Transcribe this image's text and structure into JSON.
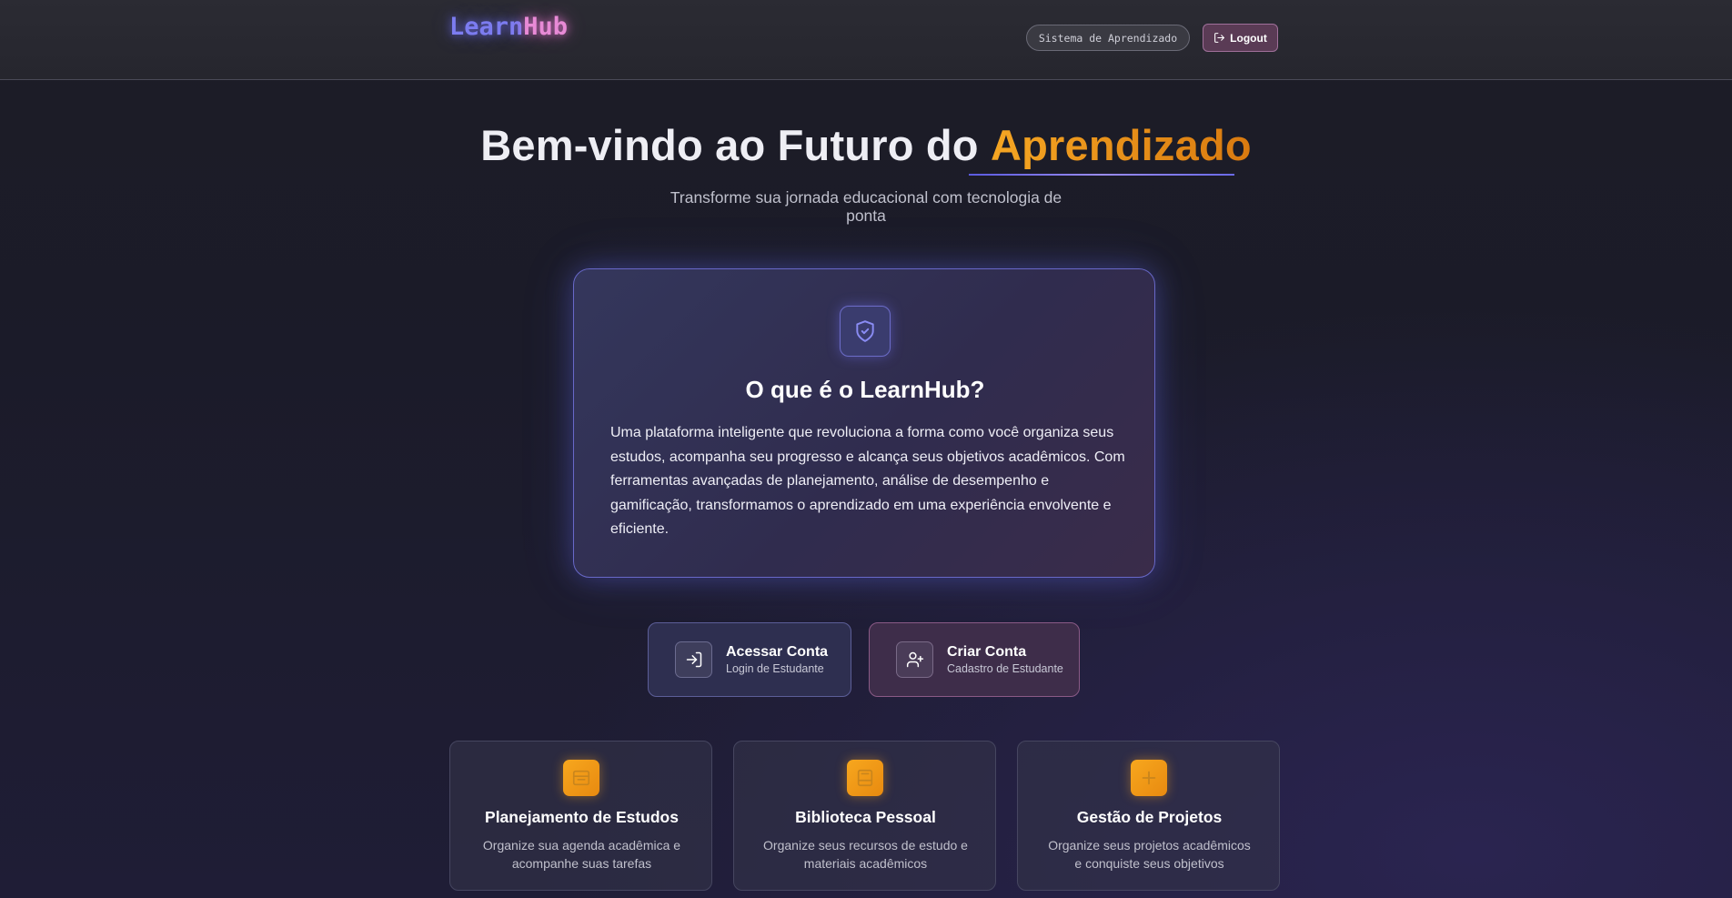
{
  "header": {
    "logo_part1": "Learn",
    "logo_part2": "Hub",
    "system_label": "Sistema de Aprendizado",
    "logout_label": "Logout"
  },
  "hero": {
    "title_main": "Bem-vindo ao Futuro do ",
    "title_accent": "Aprendizado",
    "subtitle": "Transforme sua jornada educacional com tecnologia de ponta"
  },
  "about": {
    "icon": "shield-check-icon",
    "title": "O que é o LearnHub?",
    "text": "Uma plataforma inteligente que revoluciona a forma como você organiza seus estudos, acompanha seu progresso e alcança seus objetivos acadêmicos. Com ferramentas avançadas de planejamento, análise de desempenho e gamificação, transformamos o aprendizado em uma experiência envolvente e eficiente."
  },
  "actions": {
    "login": {
      "title": "Acessar Conta",
      "subtitle": "Login de Estudante",
      "icon": "login-icon"
    },
    "signup": {
      "title": "Criar Conta",
      "subtitle": "Cadastro de Estudante",
      "icon": "user-plus-icon"
    }
  },
  "features": [
    {
      "title": "Planejamento de Estudos",
      "description": "Organize sua agenda acadêmica e acompanhe suas tarefas",
      "icon": "calendar-icon"
    },
    {
      "title": "Biblioteca Pessoal",
      "description": "Organize seus recursos de estudo e materiais acadêmicos",
      "icon": "book-icon"
    },
    {
      "title": "Gestão de Projetos",
      "description": "Organize seus projetos acadêmicos e conquiste seus objetivos",
      "icon": "plus-icon"
    }
  ],
  "colors": {
    "accent_orange": "#f5a623",
    "accent_indigo": "#6a6ae8",
    "accent_pink": "#e88ad6",
    "background": "#1c1c26"
  }
}
